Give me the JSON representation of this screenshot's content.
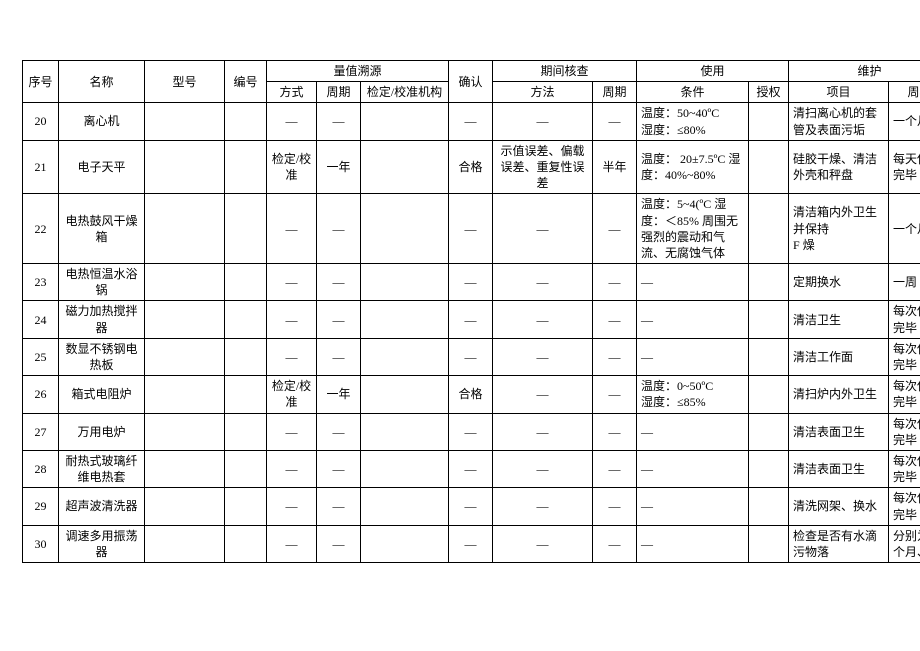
{
  "headers": {
    "seq": "序号",
    "name": "名称",
    "model": "型号",
    "no": "编号",
    "trace": "量值溯源",
    "trace_m": "方式",
    "trace_p": "周期",
    "trace_org": "检定/校准机构",
    "confirm": "确认",
    "interim": "期间核查",
    "interim_m": "方法",
    "interim_p": "周期",
    "use": "使用",
    "use_cond": "条件",
    "use_auth": "授权",
    "maint": "维护",
    "maint_item": "项目",
    "maint_p": "周期"
  },
  "rows": [
    {
      "seq": "20",
      "name": "离心机",
      "model": "",
      "no": "",
      "trace_m": "—",
      "trace_p": "—",
      "trace_org": "",
      "confirm": "—",
      "chk_m": "—",
      "chk_p": "—",
      "use_c": "温度：50~40ºC\n湿度：≤80%",
      "use_a": "",
      "mnt_i": "清扫离心机的套管及表面污垢",
      "mnt_p": "一个月"
    },
    {
      "seq": "21",
      "name": "电子天平",
      "model": "",
      "no": "",
      "trace_m": "检定/校准",
      "trace_p": "一年",
      "trace_org": "",
      "confirm": "合格",
      "chk_m": "示值误差、偏载误差、重复性误差",
      "chk_p": "半年",
      "use_c": "温度： 20±7.5ºC 湿度：40%~80%",
      "use_a": "",
      "mnt_i": "硅胶干燥、清洁外壳和秤盘",
      "mnt_p": "每天使用完毕"
    },
    {
      "seq": "22",
      "name": "电热鼓风干燥箱",
      "model": "",
      "no": "",
      "trace_m": "—",
      "trace_p": "—",
      "trace_org": "",
      "confirm": "—",
      "chk_m": "—",
      "chk_p": "—",
      "use_c": "温度：5~4(ºC 湿度：＜85% 周围无强烈的震动和气流、无腐蚀气体",
      "use_a": "",
      "mnt_i": "清洁箱内外卫生并保持\n F 燥",
      "mnt_p": "一个月"
    },
    {
      "seq": "23",
      "name": "电热恒温水浴锅",
      "model": "",
      "no": "",
      "trace_m": "—",
      "trace_p": "—",
      "trace_org": "",
      "confirm": "—",
      "chk_m": "—",
      "chk_p": "—",
      "use_c": "—",
      "use_a": "",
      "mnt_i": "定期换水",
      "mnt_p": "一周"
    },
    {
      "seq": "24",
      "name": "磁力加热搅拌器",
      "model": "",
      "no": "",
      "trace_m": "—",
      "trace_p": "—",
      "trace_org": "",
      "confirm": "—",
      "chk_m": "—",
      "chk_p": "—",
      "use_c": "—",
      "use_a": "",
      "mnt_i": "清洁卫生",
      "mnt_p": "每次使用完毕"
    },
    {
      "seq": "25",
      "name": "数显不锈钢电热板",
      "model": "",
      "no": "",
      "trace_m": "—",
      "trace_p": "—",
      "trace_org": "",
      "confirm": "—",
      "chk_m": "—",
      "chk_p": "—",
      "use_c": "—",
      "use_a": "",
      "mnt_i": "清洁工作面",
      "mnt_p": "每次使用完毕"
    },
    {
      "seq": "26",
      "name": "箱式电阻炉",
      "model": "",
      "no": "",
      "trace_m": "检定/校准",
      "trace_p": "一年",
      "trace_org": "",
      "confirm": "合格",
      "chk_m": "—",
      "chk_p": "—",
      "use_c": "温度：0~50ºC\n湿度：≤85%",
      "use_a": "",
      "mnt_i": "清扫炉内外卫生",
      "mnt_p": "每次使用完毕"
    },
    {
      "seq": "27",
      "name": "万用电炉",
      "model": "",
      "no": "",
      "trace_m": "—",
      "trace_p": "—",
      "trace_org": "",
      "confirm": "—",
      "chk_m": "—",
      "chk_p": "—",
      "use_c": "—",
      "use_a": "",
      "mnt_i": "清洁表面卫生",
      "mnt_p": "每次使用完毕"
    },
    {
      "seq": "28",
      "name": "耐热式玻璃纤维电热套",
      "model": "",
      "no": "",
      "trace_m": "—",
      "trace_p": "—",
      "trace_org": "",
      "confirm": "—",
      "chk_m": "—",
      "chk_p": "—",
      "use_c": "—",
      "use_a": "",
      "mnt_i": "清洁表面卫生",
      "mnt_p": "每次使用完毕"
    },
    {
      "seq": "29",
      "name": "超声波清洗器",
      "model": "",
      "no": "",
      "trace_m": "—",
      "trace_p": "—",
      "trace_org": "",
      "confirm": "—",
      "chk_m": "—",
      "chk_p": "—",
      "use_c": "—",
      "use_a": "",
      "mnt_i": "清洗网架、换水",
      "mnt_p": "每次使用完毕"
    },
    {
      "seq": "30",
      "name": "调速多用振荡器",
      "model": "",
      "no": "",
      "trace_m": "—",
      "trace_p": "—",
      "trace_org": "",
      "confirm": "—",
      "chk_m": "—",
      "chk_p": "—",
      "use_c": "—",
      "use_a": "",
      "mnt_i": "检查是否有水滴污物落",
      "mnt_p": "分别为三个月、六"
    }
  ]
}
